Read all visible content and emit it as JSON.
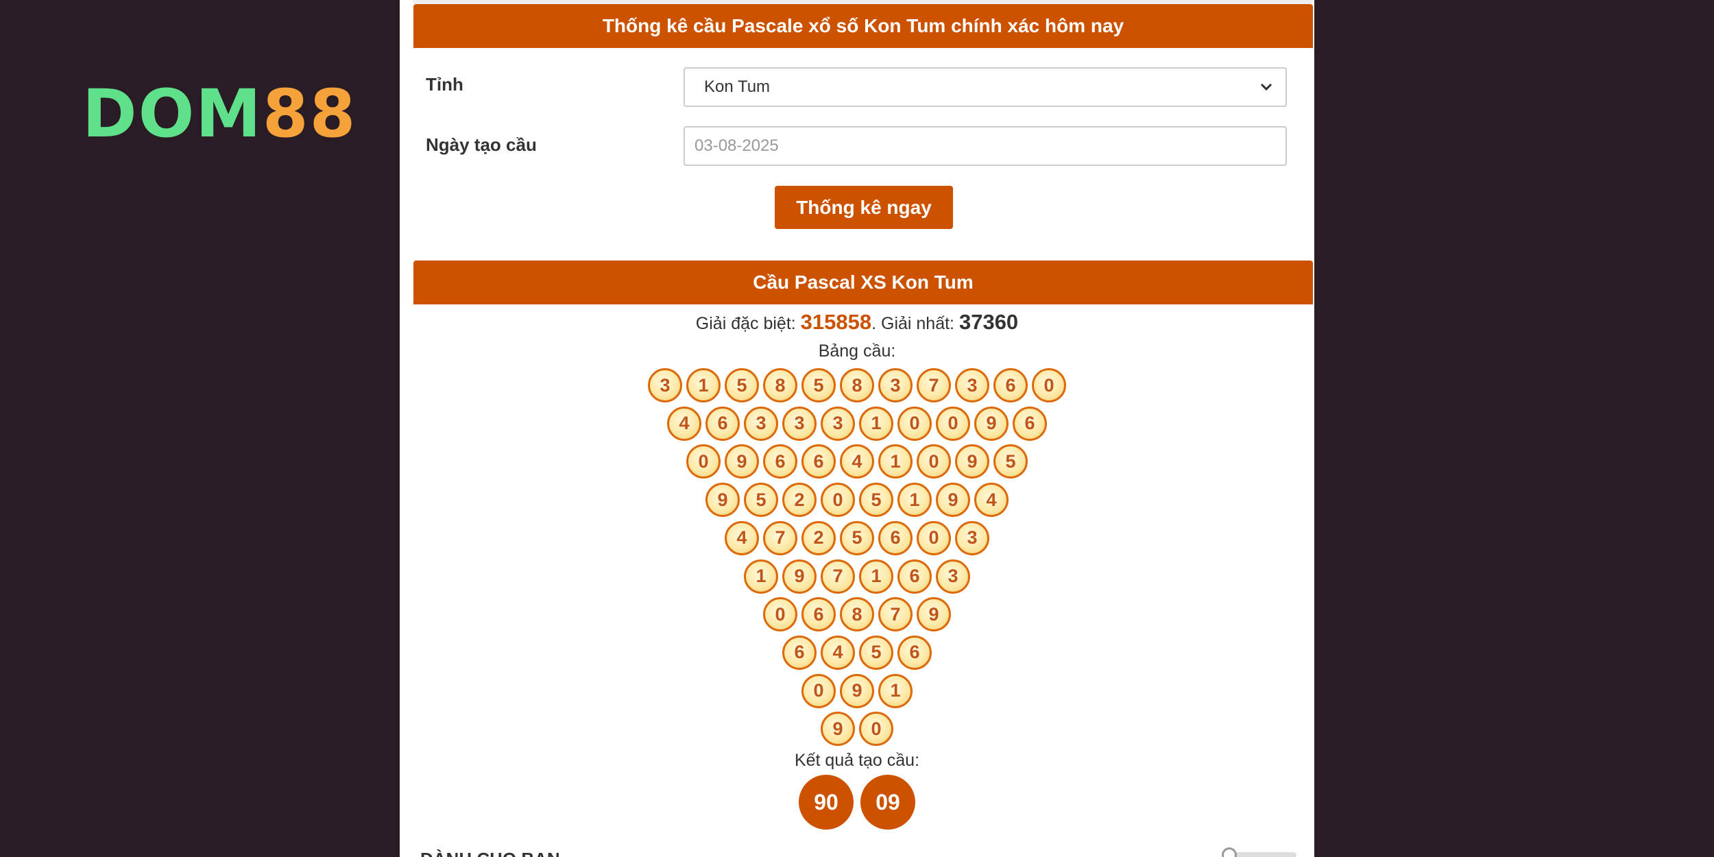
{
  "brand": {
    "logo_left": "DOM",
    "logo_right": "88"
  },
  "form": {
    "title": "Thống kê cầu Pascale xổ số Kon Tum chính xác hôm nay",
    "province_label": "Tỉnh",
    "province_value": "Kon Tum",
    "date_label": "Ngày tạo cầu",
    "date_placeholder": "03-08-2025",
    "submit_label": "Thống kê ngay"
  },
  "result_section": {
    "title": "Cầu Pascal XS Kon Tum",
    "special_label": "Giải đặc biệt: ",
    "special_value": "315858",
    "first_label": ". Giải nhất: ",
    "first_value": "37360",
    "grid_label": "Bảng cầu:",
    "grid_rows": [
      [
        "3",
        "1",
        "5",
        "8",
        "5",
        "8",
        "3",
        "7",
        "3",
        "6",
        "0"
      ],
      [
        "4",
        "6",
        "3",
        "3",
        "3",
        "1",
        "0",
        "0",
        "9",
        "6"
      ],
      [
        "0",
        "9",
        "6",
        "6",
        "4",
        "1",
        "0",
        "9",
        "5"
      ],
      [
        "9",
        "5",
        "2",
        "0",
        "5",
        "1",
        "9",
        "4"
      ],
      [
        "4",
        "7",
        "2",
        "5",
        "6",
        "0",
        "3"
      ],
      [
        "1",
        "9",
        "7",
        "1",
        "6",
        "3"
      ],
      [
        "0",
        "6",
        "8",
        "7",
        "9"
      ],
      [
        "6",
        "4",
        "5",
        "6"
      ],
      [
        "0",
        "9",
        "1"
      ],
      [
        "9",
        "0"
      ]
    ],
    "result_label": "Kết quả tạo cầu:",
    "results": [
      "90",
      "09"
    ]
  },
  "footer": {
    "next_section_label": "DÀNH CHO BẠN"
  },
  "colors": {
    "accent": "#cc5200",
    "background": "#2a1c24",
    "logo_green": "#5fe08a",
    "logo_orange": "#f6a23a"
  }
}
